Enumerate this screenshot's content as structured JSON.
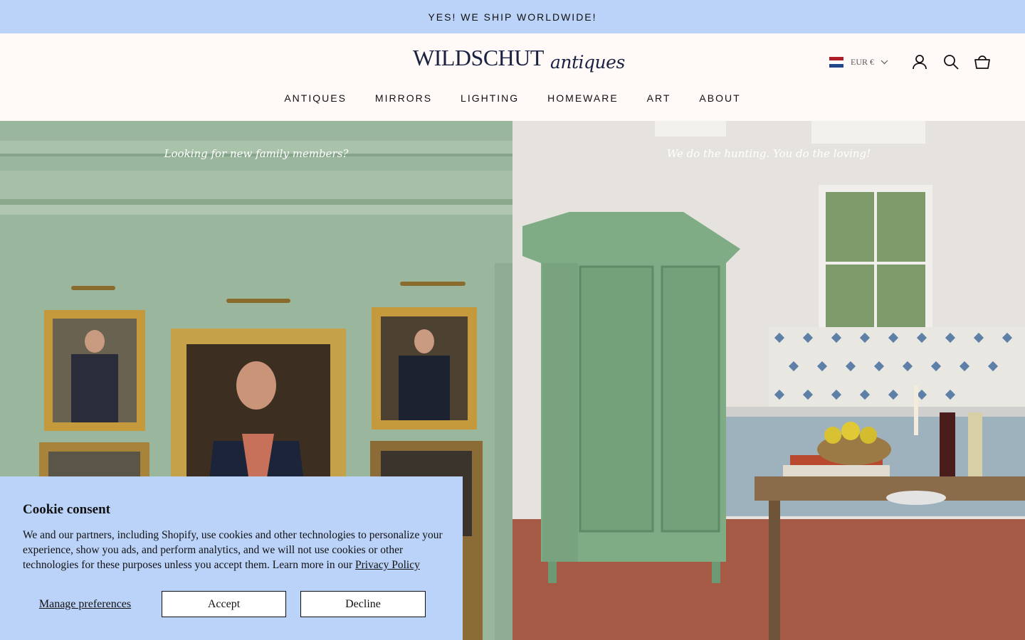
{
  "announcement": "YES! WE SHIP WORLDWIDE!",
  "logo": {
    "main": "WILDSCHUT",
    "script": "antiques"
  },
  "currency": {
    "label": "EUR €",
    "flag": "netherlands-flag"
  },
  "header_icons": [
    "account-icon",
    "search-icon",
    "cart-icon"
  ],
  "nav": [
    "ANTIQUES",
    "MIRRORS",
    "LIGHTING",
    "HOMEWARE",
    "ART",
    "ABOUT"
  ],
  "hero": {
    "left_tagline": "Looking for new family members?",
    "right_tagline": "We do the hunting. You do the loving!"
  },
  "cookie": {
    "title": "Cookie consent",
    "body": "We and our partners, including Shopify, use cookies and other technologies to personalize your experience, show you ads, and perform analytics, and we will not use cookies or other technologies for these purposes unless you accept them. Learn more in our ",
    "link": "Privacy Policy",
    "manage": "Manage preferences",
    "accept": "Accept",
    "decline": "Decline"
  },
  "colors": {
    "announcement_bg": "#bcd3f9",
    "header_bg": "#fffaf7",
    "logo": "#1a2142",
    "cookie_bg": "#bcd3f9"
  }
}
